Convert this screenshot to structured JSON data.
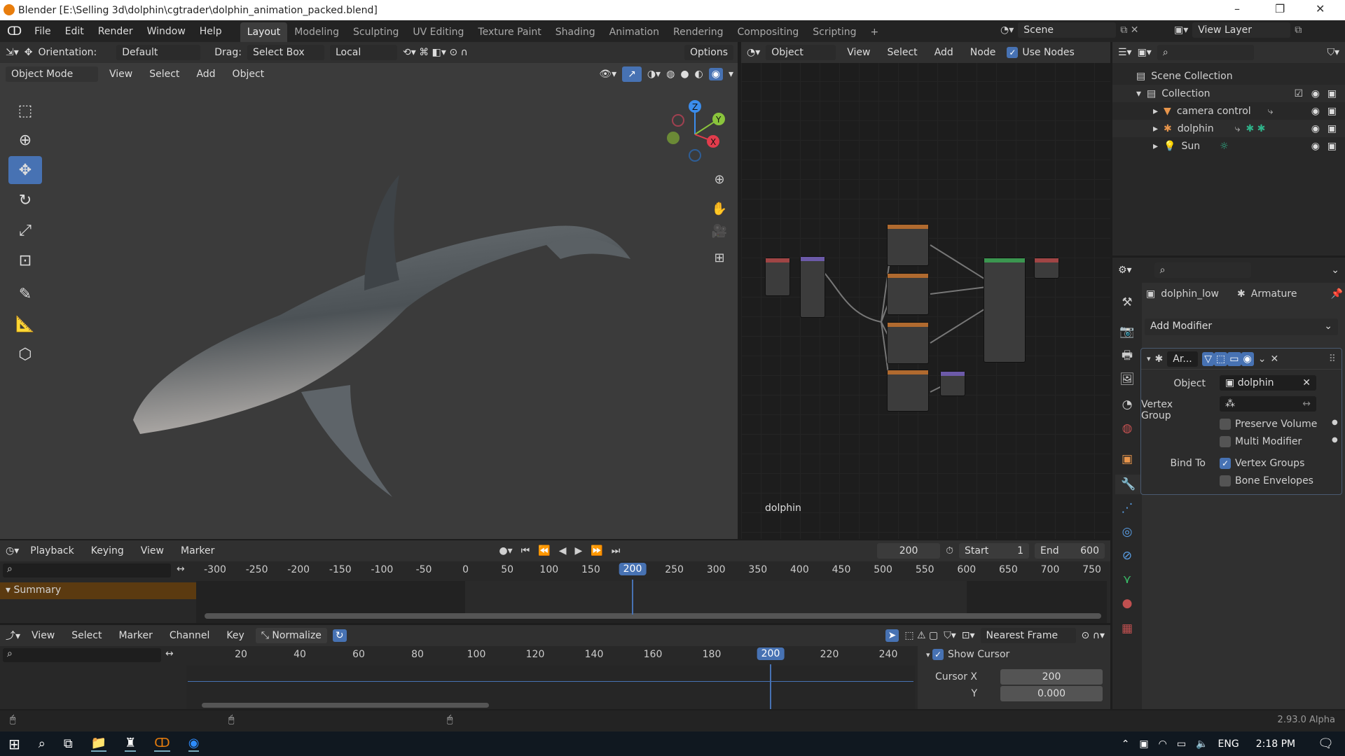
{
  "title": "Blender [E:\\Selling 3d\\dolphin\\cgtrader\\dolphin_animation_packed.blend]",
  "window_controls": {
    "minimize": "–",
    "maximize": "❐",
    "close": "✕"
  },
  "menu": [
    "File",
    "Edit",
    "Render",
    "Window",
    "Help"
  ],
  "workspaces": [
    "Layout",
    "Modeling",
    "Sculpting",
    "UV Editing",
    "Texture Paint",
    "Shading",
    "Animation",
    "Rendering",
    "Compositing",
    "Scripting",
    "+"
  ],
  "scene": "Scene",
  "view_layer": "View Layer",
  "viewport": {
    "orientation_label": "Orientation:",
    "orientation": "Default",
    "drag_label": "Drag:",
    "drag": "Select Box",
    "pivot": "Local",
    "options": "Options",
    "mode": "Object Mode",
    "menus": [
      "View",
      "Select",
      "Add",
      "Object"
    ],
    "gizmo": {
      "z": "Z",
      "y": "Y",
      "x": "X"
    }
  },
  "node_editor": {
    "type": "Object",
    "menus": [
      "View",
      "Select",
      "Add",
      "Node"
    ],
    "use_nodes": "Use Nodes",
    "object_name": "dolphin"
  },
  "outliner": {
    "scene_collection": "Scene Collection",
    "collection": "Collection",
    "items": [
      "camera control",
      "dolphin",
      "Sun"
    ]
  },
  "properties": {
    "object": "dolphin_low",
    "data": "Armature",
    "add_modifier": "Add Modifier",
    "modifier_name": "Ar...",
    "object_label": "Object",
    "object_value": "dolphin",
    "vertex_group_label": "Vertex Group",
    "preserve_volume": "Preserve Volume",
    "multi_modifier": "Multi Modifier",
    "bind_to": "Bind To",
    "vertex_groups": "Vertex Groups",
    "bone_envelopes": "Bone Envelopes",
    "checks": {
      "preserve_volume": false,
      "multi_modifier": false,
      "vertex_groups": true,
      "bone_envelopes": false
    }
  },
  "timeline": {
    "menus": [
      "Playback",
      "Keying",
      "View",
      "Marker"
    ],
    "current_frame": "200",
    "start_label": "Start",
    "start": "1",
    "end_label": "End",
    "end": "600",
    "ticks": [
      "-300",
      "-250",
      "-200",
      "-150",
      "-100",
      "-50",
      "0",
      "50",
      "100",
      "150",
      "200",
      "250",
      "300",
      "350",
      "400",
      "450",
      "500",
      "550",
      "600",
      "650",
      "700",
      "750"
    ],
    "cursor": "200",
    "summary": "Summary"
  },
  "graph": {
    "menus": [
      "View",
      "Select",
      "Marker",
      "Channel",
      "Key"
    ],
    "normalize": "Normalize",
    "interpolation": "Nearest Frame",
    "ticks": [
      "20",
      "40",
      "60",
      "80",
      "100",
      "120",
      "140",
      "160",
      "180",
      "200",
      "220",
      "240"
    ],
    "cursor": "200",
    "show_cursor": "Show Cursor",
    "cursor_x_label": "Cursor X",
    "cursor_x": "200",
    "y_label": "Y",
    "y": "0.000"
  },
  "status": {
    "version": "2.93.0 Alpha"
  },
  "taskbar": {
    "lang": "ENG",
    "time": "2:18 PM"
  }
}
